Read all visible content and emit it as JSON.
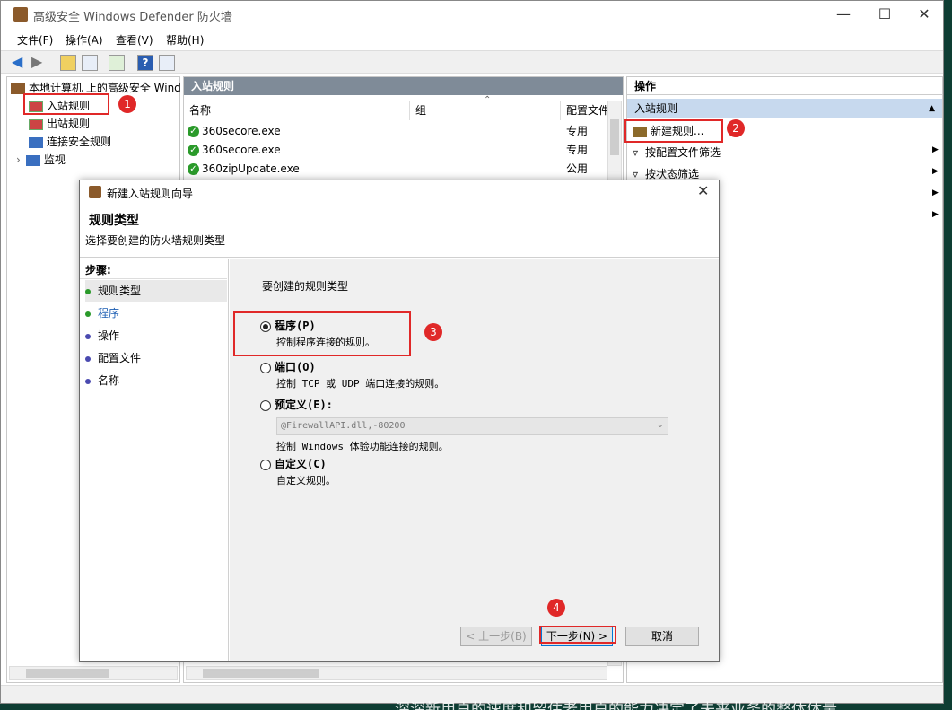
{
  "window": {
    "title": "高级安全 Windows Defender 防火墙"
  },
  "menu": [
    "文件(F)",
    "操作(A)",
    "查看(V)",
    "帮助(H)"
  ],
  "tree": {
    "root": "本地计算机 上的高级安全 Wind",
    "items": [
      "入站规则",
      "出站规则",
      "连接安全规则",
      "监视"
    ]
  },
  "list": {
    "header": "入站规则",
    "columns": [
      "名称",
      "组",
      "配置文件"
    ],
    "rows": [
      {
        "name": "360secore.exe",
        "profile": "专用"
      },
      {
        "name": "360secore.exe",
        "profile": "专用"
      },
      {
        "name": "360zipUpdate.exe",
        "profile": "公用"
      }
    ]
  },
  "actions": {
    "header": "操作",
    "section": "入站规则",
    "items": [
      "新建规则...",
      "按配置文件筛选",
      "按状态筛选"
    ]
  },
  "dialog": {
    "title": "新建入站规则向导",
    "heading": "规则类型",
    "subheading": "选择要创建的防火墙规则类型",
    "steps_label": "步骤:",
    "steps": [
      "规则类型",
      "程序",
      "操作",
      "配置文件",
      "名称"
    ],
    "prompt": "要创建的规则类型",
    "options": [
      {
        "label": "程序(P)",
        "desc": "控制程序连接的规则。",
        "selected": true
      },
      {
        "label": "端口(O)",
        "desc": "控制 TCP 或 UDP 端口连接的规则。",
        "selected": false
      },
      {
        "label": "预定义(E):",
        "desc": "控制 Windows 体验功能连接的规则。",
        "selected": false,
        "combo": "@FirewallAPI.dll,-80200"
      },
      {
        "label": "自定义(C)",
        "desc": "自定义规则。",
        "selected": false
      }
    ],
    "buttons": {
      "back": "< 上一步(B)",
      "next": "下一步(N) >",
      "cancel": "取消"
    }
  },
  "badges": [
    "1",
    "2",
    "3",
    "4"
  ],
  "overlay": "深深新用户的速度和留住老用户的能力决定了未来业务的整体体量",
  "colors": {
    "accent_red": "#e02828",
    "pane_header": "#7f8b98",
    "action_section": "#c7d9ee"
  }
}
